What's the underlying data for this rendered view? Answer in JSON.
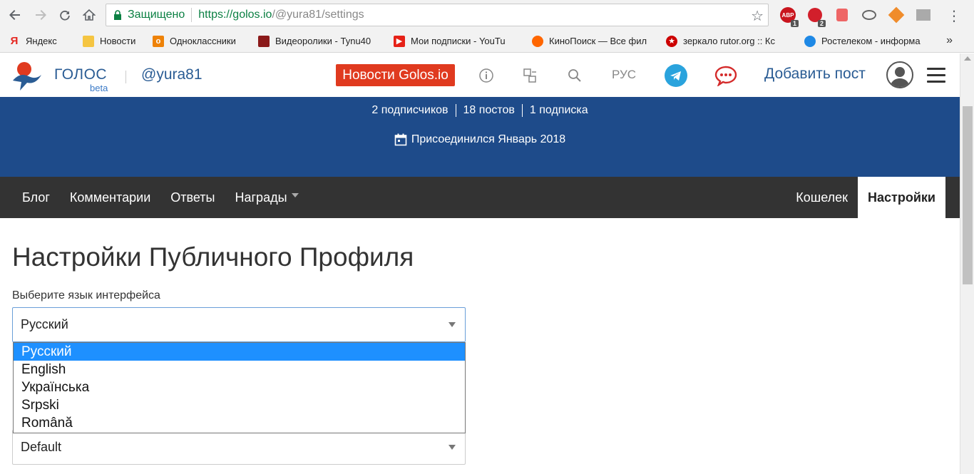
{
  "browser": {
    "secure_label": "Защищено",
    "url_scheme_host": "https://golos.io",
    "url_path": "/@yura81/settings"
  },
  "bookmarks": [
    {
      "label": "Яндекс",
      "icon": "yandex-icon",
      "color": "#e52620"
    },
    {
      "label": "Новости",
      "icon": "folder-icon",
      "color": "#f5c542"
    },
    {
      "label": "Одноклассники",
      "icon": "ok-icon",
      "color": "#ee8208"
    },
    {
      "label": "Видеоролики - Tynu40",
      "icon": "video-icon",
      "color": "#8b1a1a"
    },
    {
      "label": "Мои подписки - YouTu",
      "icon": "youtube-icon",
      "color": "#e62117"
    },
    {
      "label": "КиноПоиск — Все фил",
      "icon": "kinopoisk-icon",
      "color": "#f60"
    },
    {
      "label": "зеркало rutor.org :: Кс",
      "icon": "rutor-icon",
      "color": "#c00"
    },
    {
      "label": "Ростелеком - информа",
      "icon": "rostelecom-icon",
      "color": "#1e88e5"
    }
  ],
  "header": {
    "brand": "ГОЛОС",
    "beta": "beta",
    "username": "@yura81",
    "news_button": "Новости Golos.io",
    "lang": "РУС",
    "add_post": "Добавить пост"
  },
  "profile": {
    "followers": "2 подписчиков",
    "posts": "18 постов",
    "following": "1 подписка",
    "joined": "Присоединился Январь 2018"
  },
  "tabs": {
    "blog": "Блог",
    "comments": "Комментарии",
    "replies": "Ответы",
    "rewards": "Награды",
    "wallet": "Кошелек",
    "settings": "Настройки"
  },
  "settings": {
    "title": "Настройки Публичного Профиля",
    "language_label": "Выберите язык интерфейса",
    "language_value": "Русский",
    "language_options": [
      "Русский",
      "English",
      "Українська",
      "Srpski",
      "Română"
    ],
    "second_select_value": "Default"
  },
  "colors": {
    "banner": "#1e4b8a",
    "news_button": "#e03a1f",
    "link_blue": "#2a5c94",
    "selected_option": "#1e90ff"
  }
}
